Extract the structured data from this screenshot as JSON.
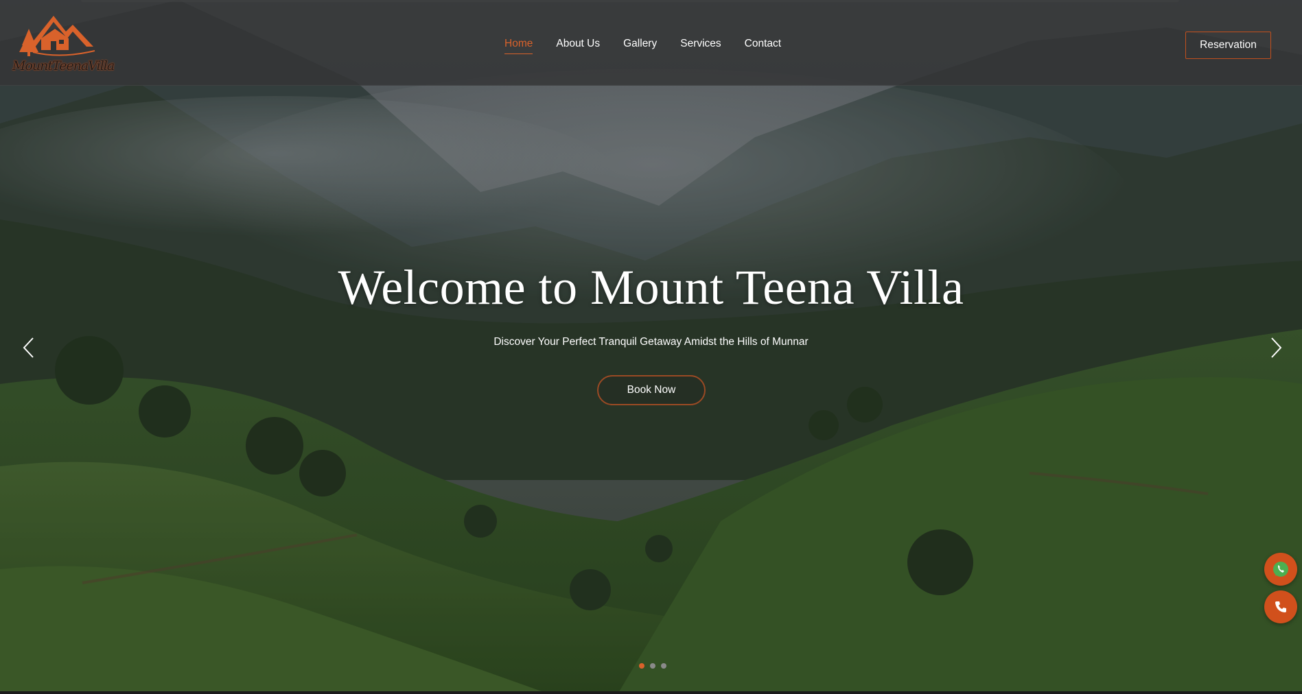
{
  "brand": {
    "logo_text": "MountTeenaVilla",
    "accent_color": "#d9622b"
  },
  "nav": {
    "items": [
      {
        "label": "Home",
        "active": true
      },
      {
        "label": "About Us",
        "active": false
      },
      {
        "label": "Gallery",
        "active": false
      },
      {
        "label": "Services",
        "active": false
      },
      {
        "label": "Contact",
        "active": false
      }
    ]
  },
  "header": {
    "reservation_label": "Reservation"
  },
  "hero": {
    "title": "Welcome to Mount Teena Villa",
    "subtitle": "Discover Your Perfect Tranquil Getaway Amidst the Hills of Munnar",
    "cta_label": "Book Now",
    "slides": {
      "count": 3,
      "active_index": 0
    },
    "prev_icon": "chevron-left-icon",
    "next_icon": "chevron-right-icon"
  },
  "floating_actions": [
    {
      "name": "whatsapp",
      "icon": "whatsapp-icon"
    },
    {
      "name": "phone",
      "icon": "phone-icon"
    }
  ]
}
